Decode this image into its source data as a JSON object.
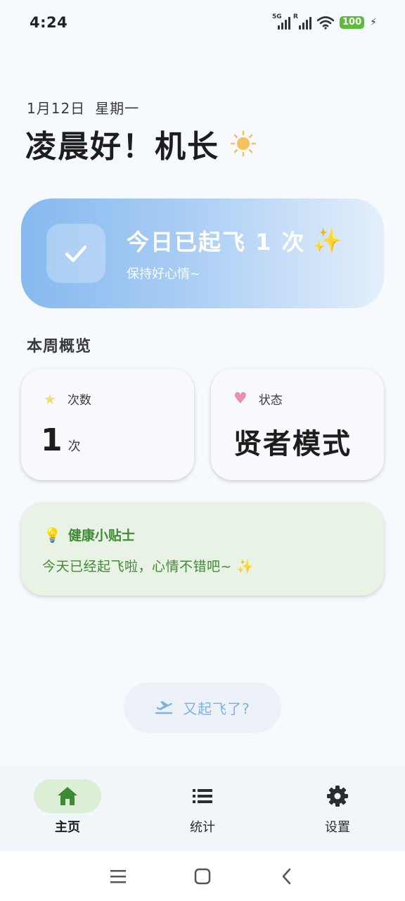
{
  "status_bar": {
    "time": "4:24",
    "signal1_tag": "5G",
    "signal2_tag": "R",
    "battery": "100"
  },
  "header": {
    "date": "1月12日",
    "weekday": "星期一",
    "greeting": "凌晨好！机长"
  },
  "hero": {
    "title": "今日已起飞 1 次",
    "sparkle": "✨",
    "subtitle": "保持好心情~"
  },
  "overview": {
    "title": "本周概览",
    "count_card": {
      "label": "次数",
      "value": "1",
      "unit": "次"
    },
    "status_card": {
      "label": "状态",
      "value": "贤者模式"
    }
  },
  "tip": {
    "title": "健康小贴士",
    "text": "今天已经起飞啦，心情不错吧~",
    "sparkle": "✨"
  },
  "action_button": {
    "label": "又起飞了?"
  },
  "bottom_nav": {
    "items": [
      {
        "label": "主页",
        "icon": "home-icon",
        "active": true
      },
      {
        "label": "统计",
        "icon": "list-icon",
        "active": false
      },
      {
        "label": "设置",
        "icon": "gear-icon",
        "active": false
      }
    ]
  },
  "colors": {
    "accent_blue": "#86b9ef",
    "tip_green": "#3f8a34",
    "active_nav_bg": "#dcefd6"
  }
}
